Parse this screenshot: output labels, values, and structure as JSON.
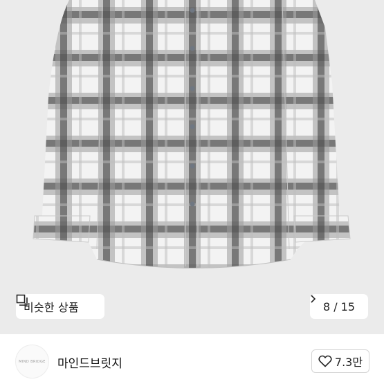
{
  "product_image": {
    "description_icon": "shirt-image"
  },
  "similar_products": {
    "label": "비슷한 상품",
    "icon": "copy-icon"
  },
  "pagination": {
    "text": "8 / 15",
    "icon": "chevron-right-icon"
  },
  "seller": {
    "name": "마인드브릿지",
    "avatar_text": "MIND BRIDGE"
  },
  "like": {
    "count": "7.3만",
    "icon": "heart-outline-icon"
  }
}
